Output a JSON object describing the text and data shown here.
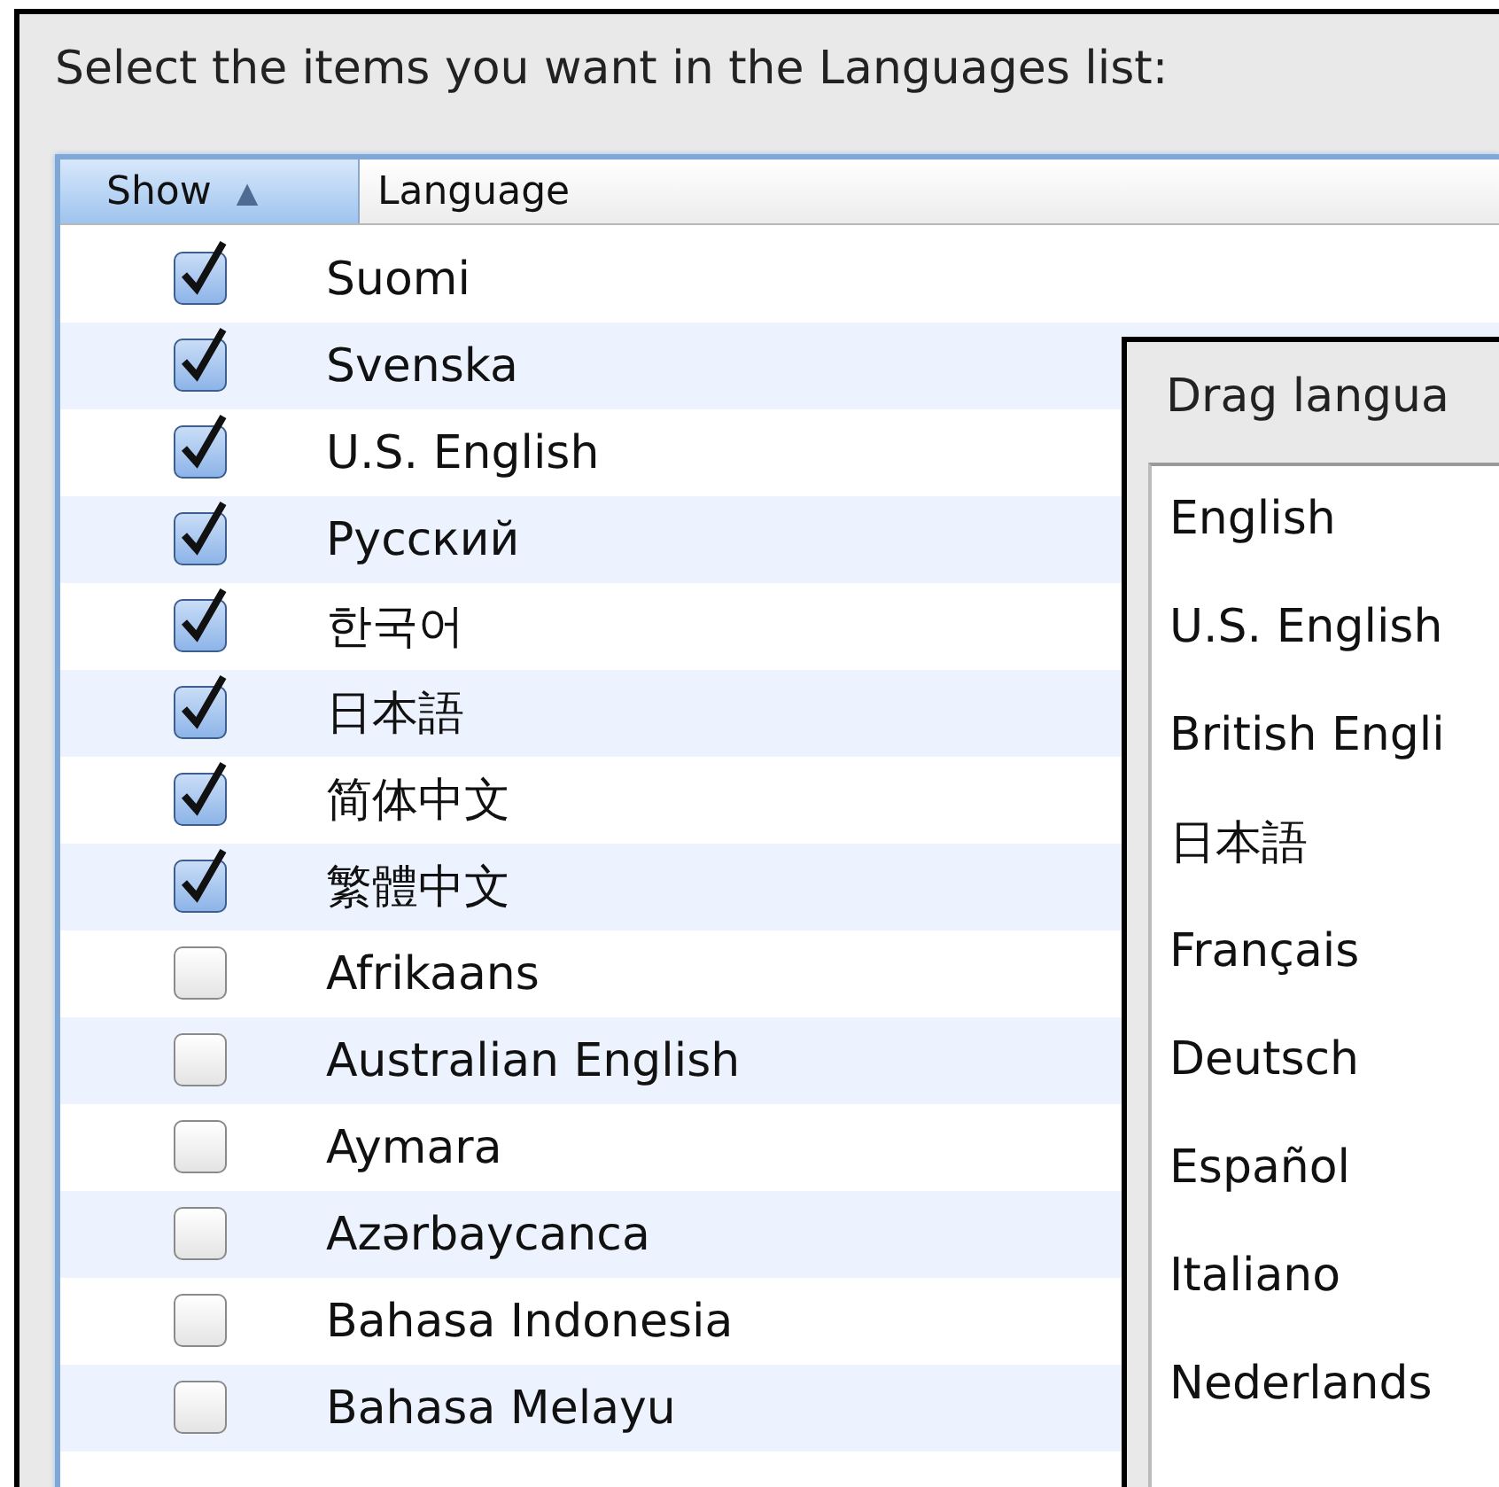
{
  "prompt": "Select the items you want in the Languages list:",
  "table": {
    "columns": [
      {
        "label": "Show",
        "sorted": true,
        "sort_glyph": "▲"
      },
      {
        "label": "Language",
        "sorted": false
      }
    ],
    "rows": [
      {
        "language": "Suomi",
        "checked": true
      },
      {
        "language": "Svenska",
        "checked": true
      },
      {
        "language": "U.S. English",
        "checked": true
      },
      {
        "language": "Русский",
        "checked": true
      },
      {
        "language": "한국어",
        "checked": true
      },
      {
        "language": "日本語",
        "checked": true
      },
      {
        "language": "简体中文",
        "checked": true
      },
      {
        "language": "繁體中文",
        "checked": true
      },
      {
        "language": "Afrikaans",
        "checked": false
      },
      {
        "language": "Australian English",
        "checked": false
      },
      {
        "language": "Aymara",
        "checked": false
      },
      {
        "language": "Azərbaycanca",
        "checked": false
      },
      {
        "language": "Bahasa Indonesia",
        "checked": false
      },
      {
        "language": "Bahasa Melayu",
        "checked": false
      }
    ]
  },
  "order_panel": {
    "title": "Drag langua",
    "items": [
      "English",
      "U.S. English",
      "British Engli",
      "日本語",
      "Français",
      "Deutsch",
      "Español",
      "Italiano",
      "Nederlands"
    ]
  }
}
